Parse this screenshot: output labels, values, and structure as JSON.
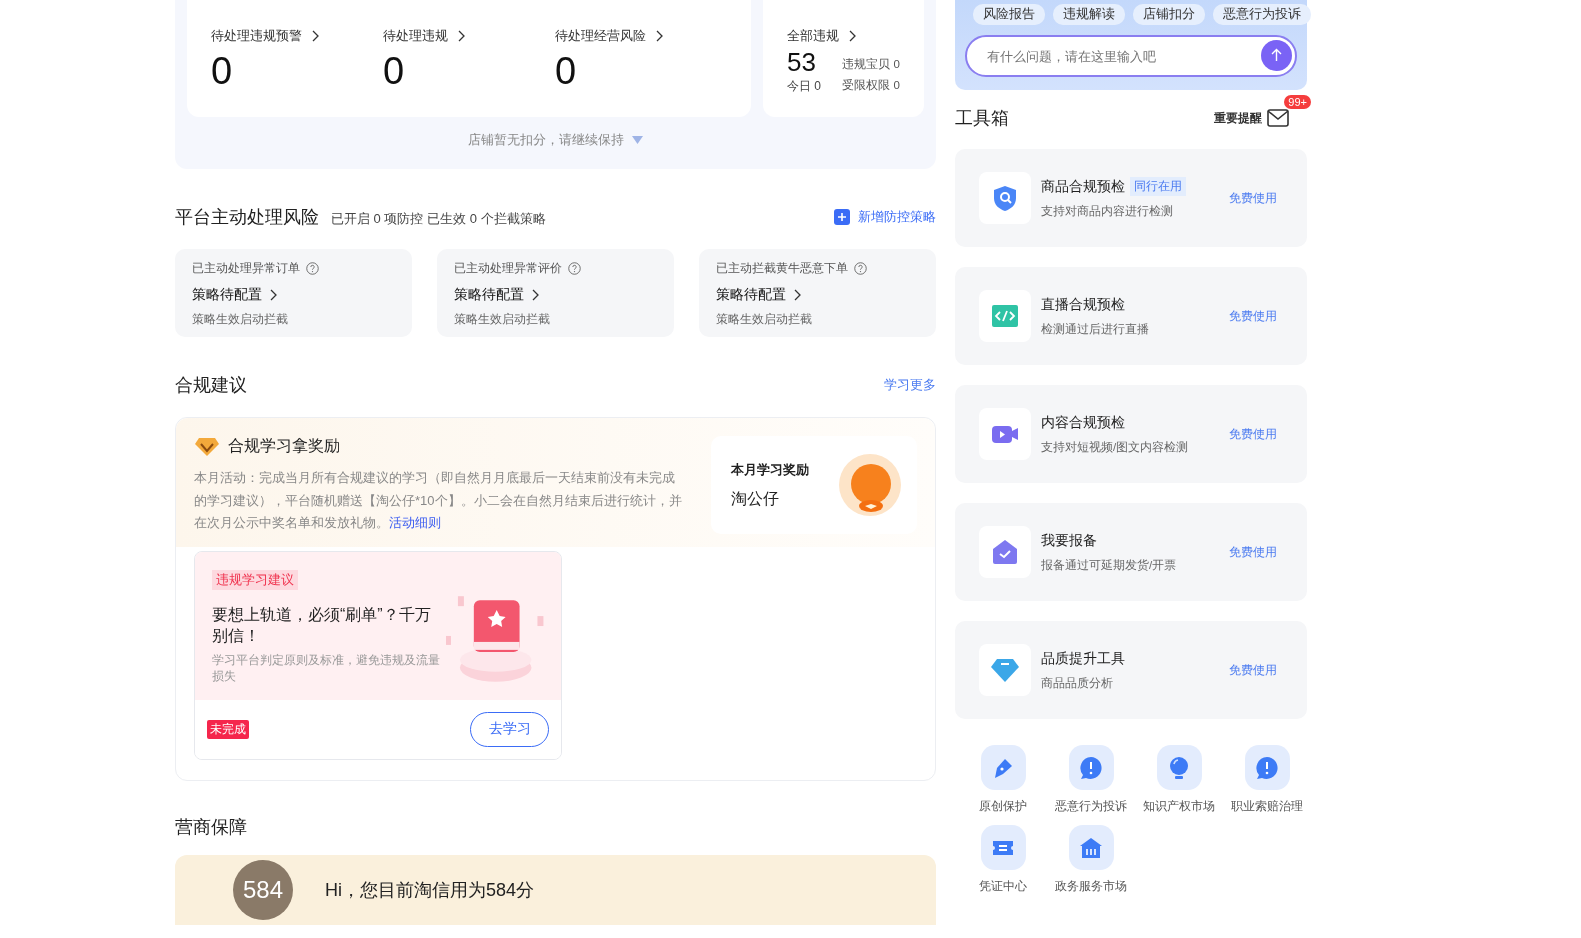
{
  "overview": {
    "stats": [
      {
        "label": "待处理违规预警",
        "value": "0"
      },
      {
        "label": "待处理违规",
        "value": "0"
      },
      {
        "label": "待处理经营风险",
        "value": "0"
      }
    ],
    "total": {
      "label": "全部违规",
      "value": "53",
      "today": "今日 0",
      "items": [
        "违规宝贝 0",
        "受限权限 0"
      ]
    },
    "footer": "店铺暂无扣分，请继续保持"
  },
  "platform_risk": {
    "title": "平台主动处理风险",
    "summary": "已开启 0 项防控 已生效 0 个拦截策略",
    "action": "新增防控策略",
    "cards": [
      {
        "label": "已主动处理异常订单",
        "status": "策略待配置",
        "note": "策略生效启动拦截"
      },
      {
        "label": "已主动处理异常评价",
        "status": "策略待配置",
        "note": "策略生效启动拦截"
      },
      {
        "label": "已主动拦截黄牛恶意下单",
        "status": "策略待配置",
        "note": "策略生效启动拦截"
      }
    ]
  },
  "compliance": {
    "title": "合规建议",
    "more": "学习更多",
    "reward": {
      "title": "合规学习拿奖励",
      "text": "本月活动：完成当月所有合规建议的学习（即自然月月底最后一天结束前没有未完成的学习建议），平台随机赠送【淘公仔*10个】。小二会在自然月结束后进行统计，并在次月公示中奖名单和发放礼物。",
      "link": "活动细则",
      "side_title": "本月学习奖励",
      "side_prize": "淘公仔"
    },
    "lessons": [
      {
        "tag": "违规学习建议",
        "headline": "要想上轨道，必须“刷单”？千万别信！",
        "desc": "学习平台判定原则及标准，避免违规及流量损失",
        "status": "未完成",
        "button": "去学习"
      }
    ]
  },
  "business": {
    "title": "营商保障",
    "score": "584",
    "greeting": "Hi，您目前淘信用为584分"
  },
  "assistant": {
    "chips": [
      "风险报告",
      "违规解读",
      "店铺扣分",
      "恶意行为投诉"
    ],
    "placeholder": "有什么问题，请在这里输入吧"
  },
  "toolbox": {
    "title": "工具箱",
    "reminder": "重要提醒",
    "badge": "99+",
    "tools": [
      {
        "name": "商品合规预检",
        "tag": "同行在用",
        "desc": "支持对商品内容进行检测",
        "action": "免费使用"
      },
      {
        "name": "直播合规预检",
        "desc": "检测通过后进行直播",
        "action": "免费使用"
      },
      {
        "name": "内容合规预检",
        "desc": "支持对短视频/图文内容检测",
        "action": "免费使用"
      },
      {
        "name": "我要报备",
        "desc": "报备通过可延期发货/开票",
        "action": "免费使用"
      },
      {
        "name": "品质提升工具",
        "desc": "商品品质分析",
        "action": "免费使用"
      }
    ],
    "shortcuts": [
      "原创保护",
      "恶意行为投诉",
      "知识产权市场",
      "职业索赔治理",
      "凭证中心",
      "政务服务市场"
    ]
  }
}
